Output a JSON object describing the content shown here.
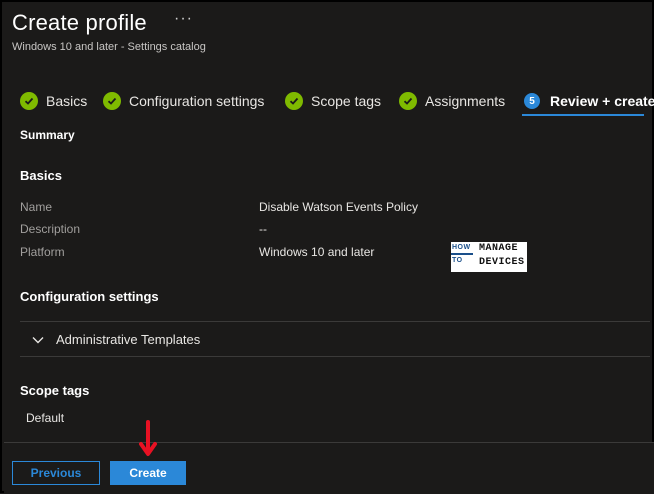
{
  "header": {
    "title": "Create profile",
    "more": "···",
    "subtitle": "Windows 10 and later - Settings catalog"
  },
  "steps": [
    {
      "label": "Basics",
      "state": "complete"
    },
    {
      "label": "Configuration settings",
      "state": "complete"
    },
    {
      "label": "Scope tags",
      "state": "complete"
    },
    {
      "label": "Assignments",
      "state": "complete"
    },
    {
      "label": "Review + create",
      "state": "active",
      "number": "5"
    }
  ],
  "summary": {
    "label": "Summary",
    "basics": {
      "heading": "Basics",
      "rows": [
        {
          "key": "Name",
          "value": "Disable Watson Events Policy"
        },
        {
          "key": "Description",
          "value": "--"
        },
        {
          "key": "Platform",
          "value": "Windows 10 and later"
        }
      ]
    },
    "configuration": {
      "heading": "Configuration settings",
      "accordion_label": "Administrative Templates"
    },
    "scope_tags": {
      "heading": "Scope tags",
      "value": "Default"
    }
  },
  "logo": {
    "line1": "HOW",
    "line2": "TO",
    "word1": "MANAGE",
    "word2": "DEVICES"
  },
  "footer": {
    "previous_label": "Previous",
    "create_label": "Create"
  },
  "colors": {
    "accent": "#2b88d8",
    "check": "#7fba00",
    "annotation_arrow": "#e81123"
  }
}
